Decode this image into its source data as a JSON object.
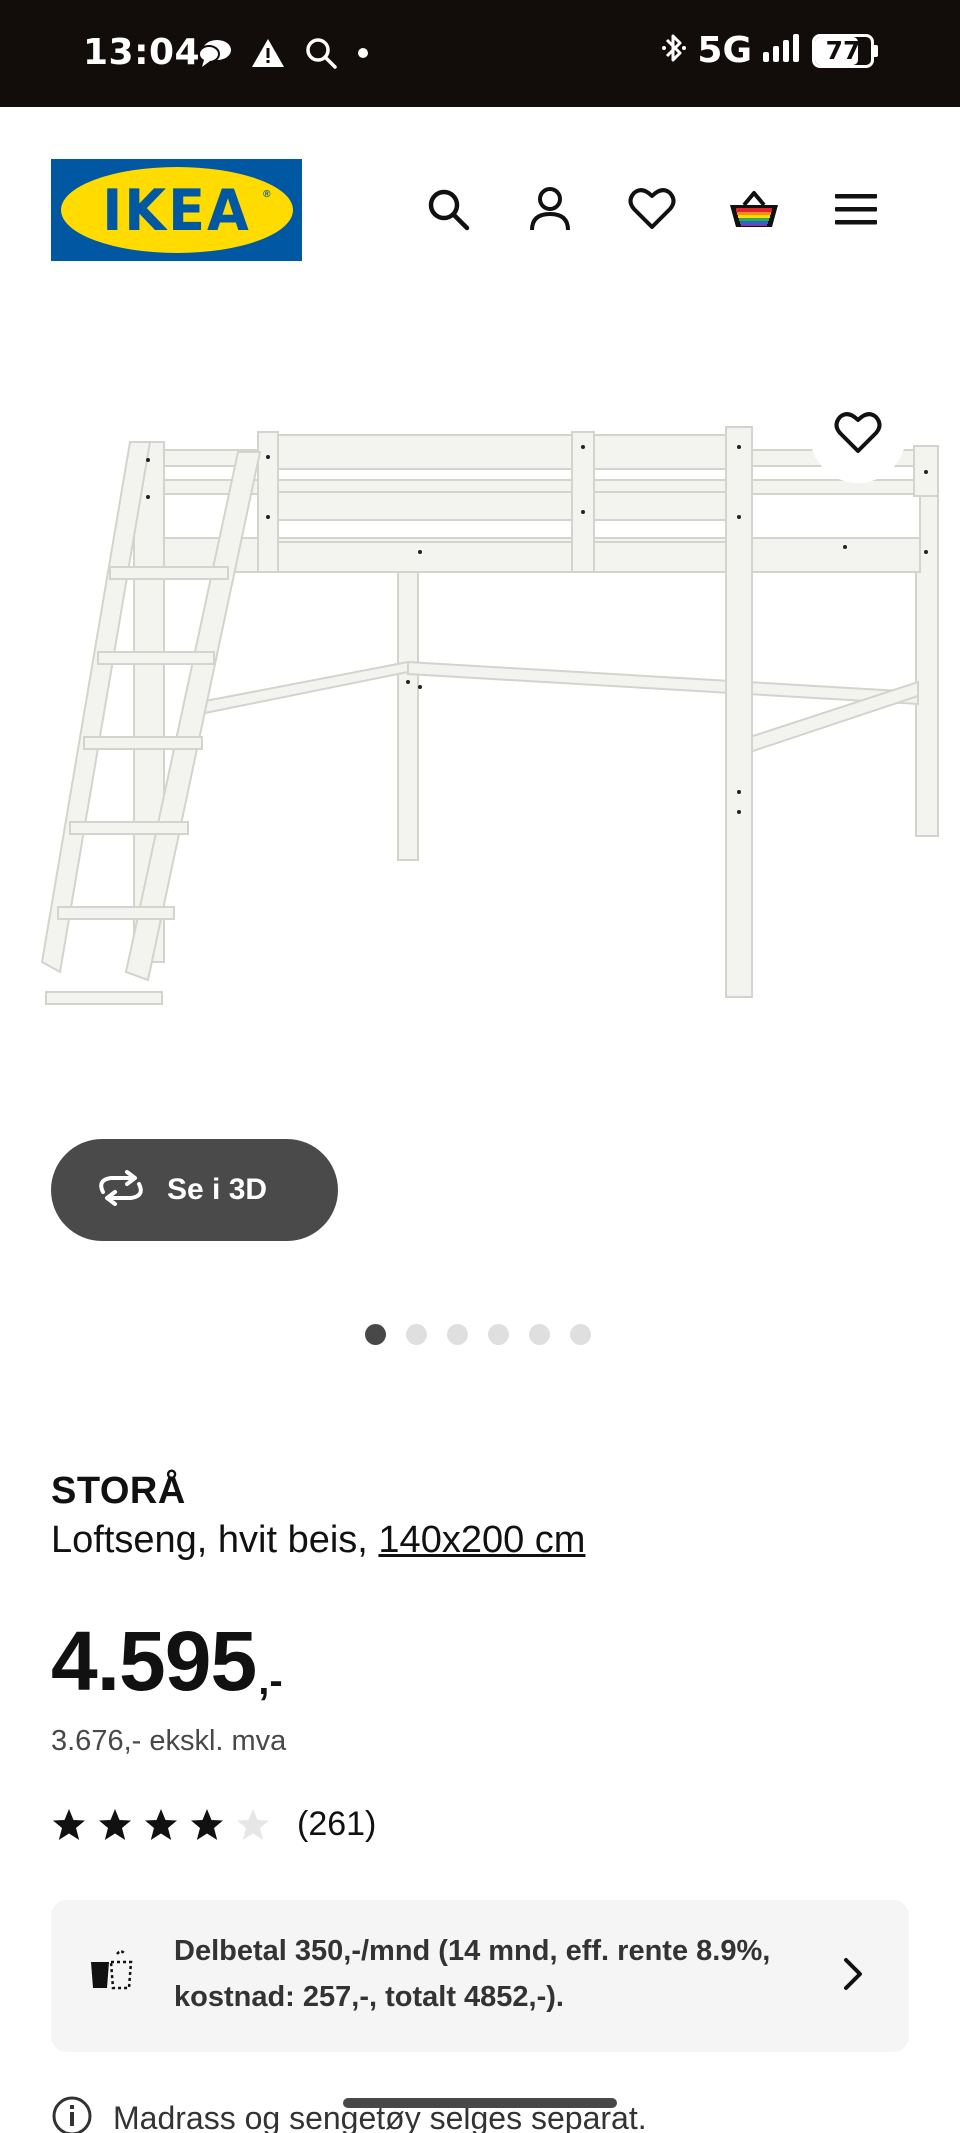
{
  "status_bar": {
    "time": "13:04",
    "network": "5G",
    "battery": "77",
    "battery_level": 0.77,
    "icons": [
      "chat-bubble-icon",
      "warning-icon",
      "search-icon",
      "dot-icon",
      "bluetooth-icon",
      "signal-icon",
      "battery-icon"
    ]
  },
  "header": {
    "logo_text": "IKEA",
    "icons": [
      "search-icon",
      "account-icon",
      "heart-icon",
      "basket-icon",
      "menu-icon"
    ]
  },
  "gallery": {
    "favourite_icon": "heart-icon",
    "view_3d_label": "Se i 3D",
    "image_count": 6,
    "active_index": 0
  },
  "product": {
    "name": "STORÅ",
    "description": "Loftseng, hvit beis,",
    "size": "140x200 cm",
    "price_integer": "4.595",
    "price_suffix": ",-",
    "price_ex_vat": "3.676,- ekskl. mva",
    "rating": 4,
    "rating_max": 5,
    "review_count": "(261)"
  },
  "finance": {
    "text": "Delbetal 350,-/mnd (14 mnd, eff. rente 8.9%, kostnad: 257,-, totalt 4852,-).",
    "icon": "installment-icon"
  },
  "notice": {
    "text": "Madrass og sengetøy selges separat.",
    "icon": "info-icon"
  },
  "colors": {
    "ikea_blue": "#0058a3",
    "ikea_yellow": "#ffdb00",
    "status_bar": "#120d0b",
    "button_3d": "#4a4a4a"
  }
}
